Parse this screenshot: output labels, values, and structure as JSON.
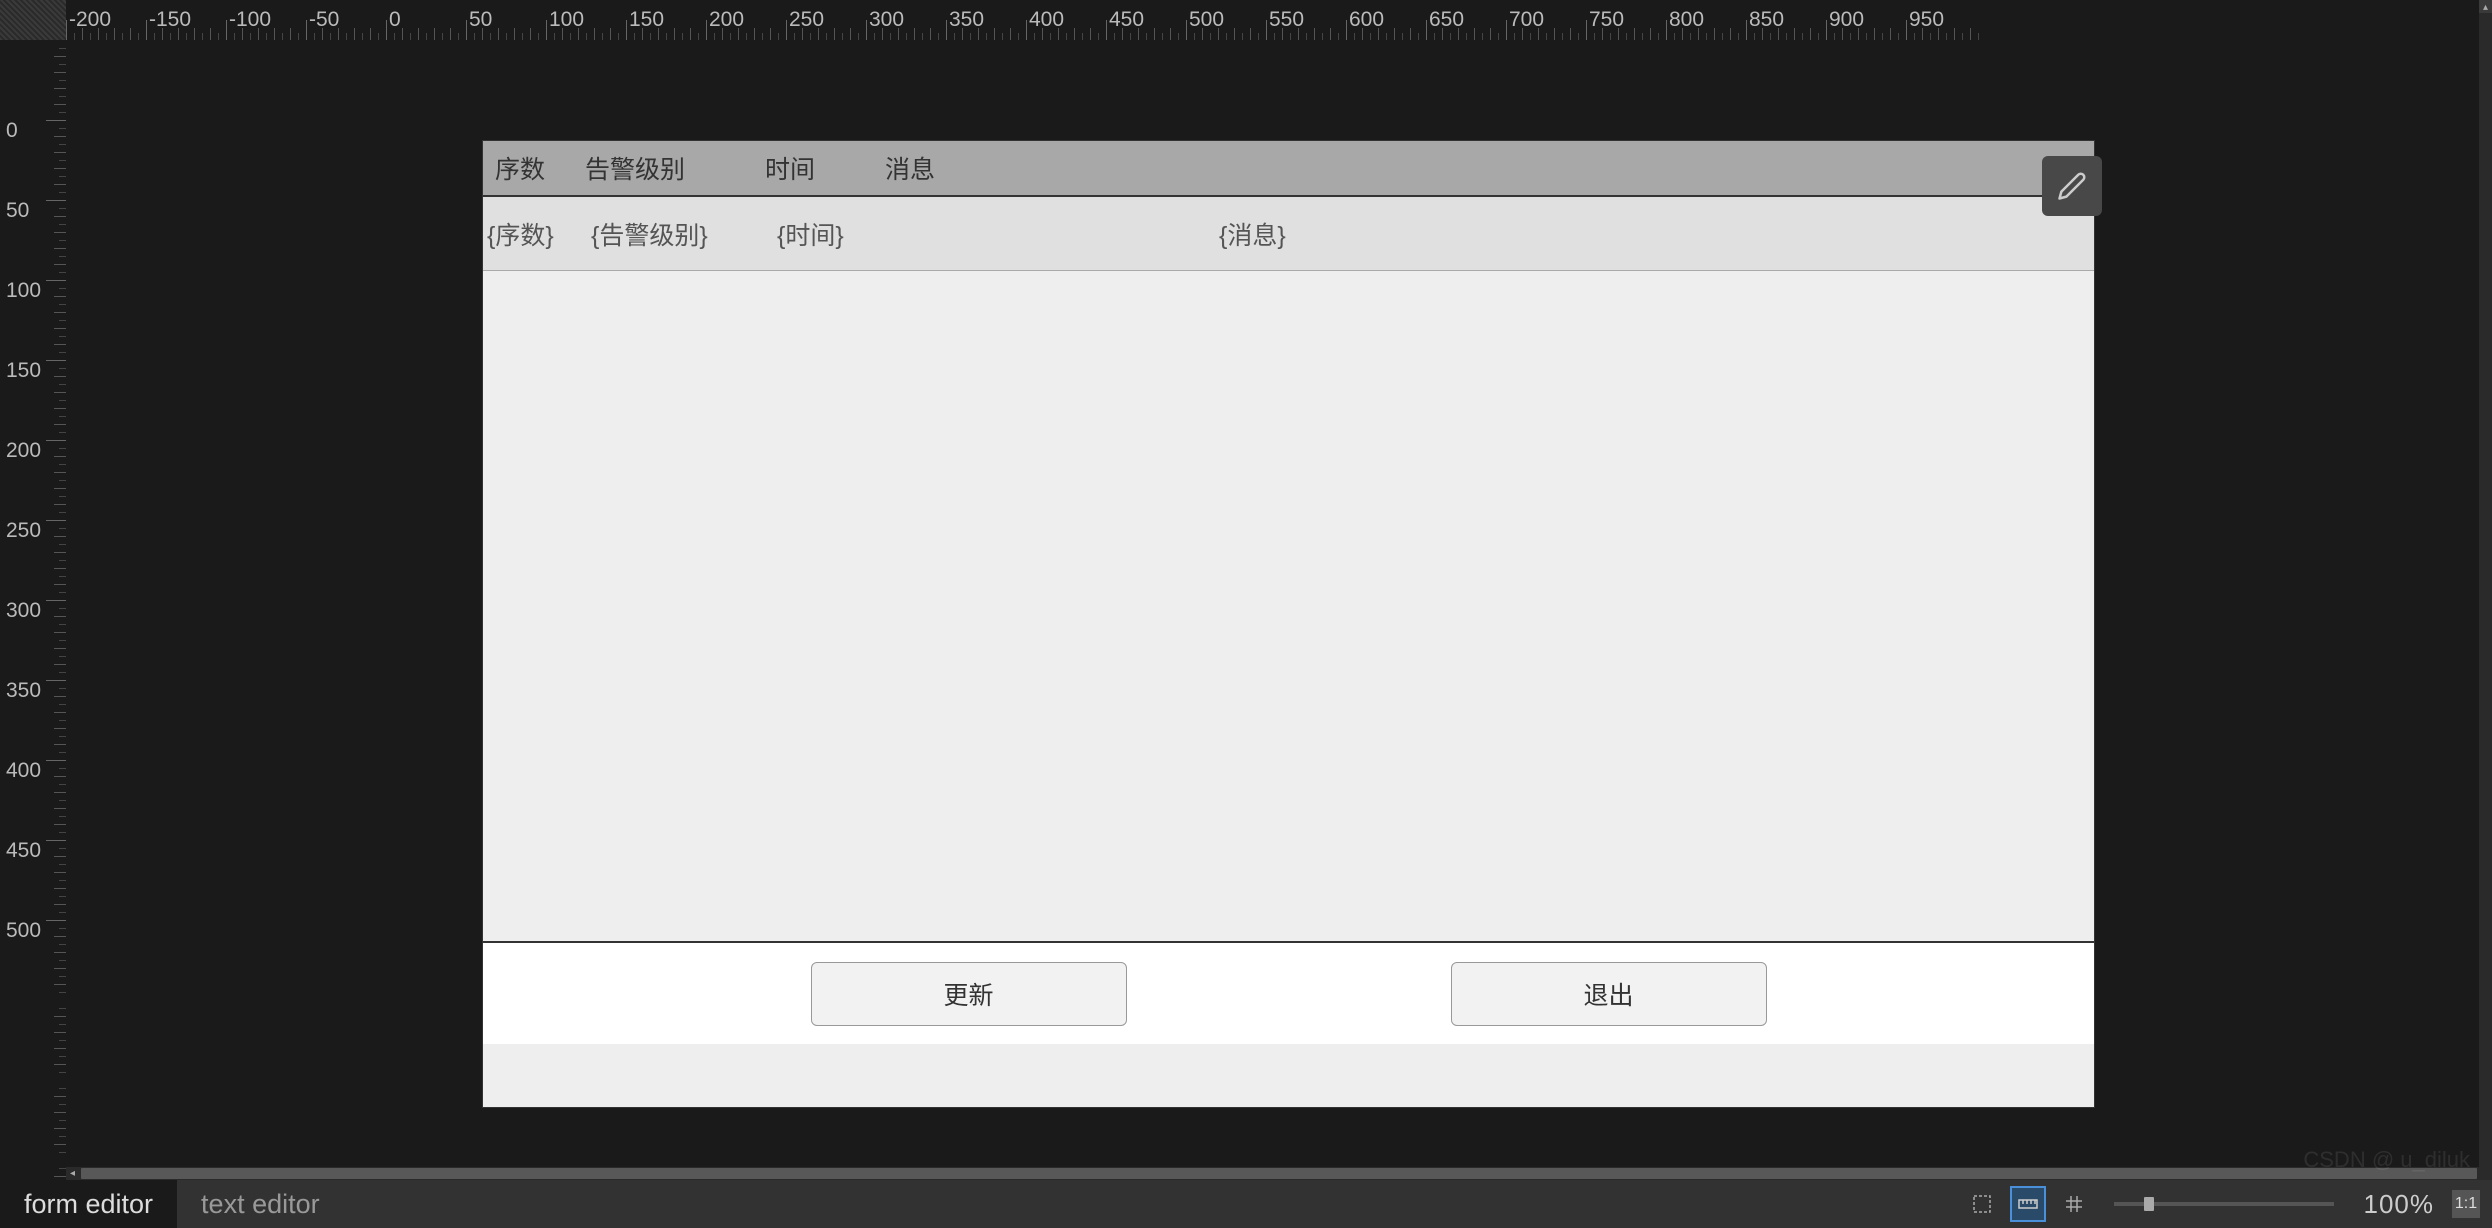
{
  "ruler": {
    "top_labels": [
      "-200",
      "-150",
      "-100",
      "-50",
      "0",
      "50",
      "100",
      "150",
      "200",
      "250",
      "300",
      "350",
      "400",
      "450",
      "500",
      "550",
      "600",
      "650",
      "700",
      "750",
      "800",
      "850",
      "900",
      "950"
    ],
    "top_start": -200,
    "top_step": 50,
    "top_pixel_per_unit": 1.6,
    "left_labels": [
      "0",
      "50",
      "100",
      "150",
      "200",
      "250",
      "300",
      "350",
      "400",
      "450",
      "500"
    ],
    "left_start": -50,
    "left_step": 50,
    "left_pixel_per_unit": 1.6
  },
  "table": {
    "header": {
      "col1": "序数",
      "col2": "告警级别",
      "col3": "时间",
      "col4": "消息",
      "col5": "/"
    },
    "template_row": {
      "col1": "{序数}",
      "col2": "{告警级别}",
      "col3": "{时间}",
      "col4": "{消息}"
    }
  },
  "buttons": {
    "update": "更新",
    "exit": "退出"
  },
  "tabs": {
    "form_editor": "form  editor",
    "text_editor": "text  editor"
  },
  "zoom": {
    "label": "100%",
    "reset": "1:1"
  },
  "watermark": "CSDN @ u_diluk"
}
